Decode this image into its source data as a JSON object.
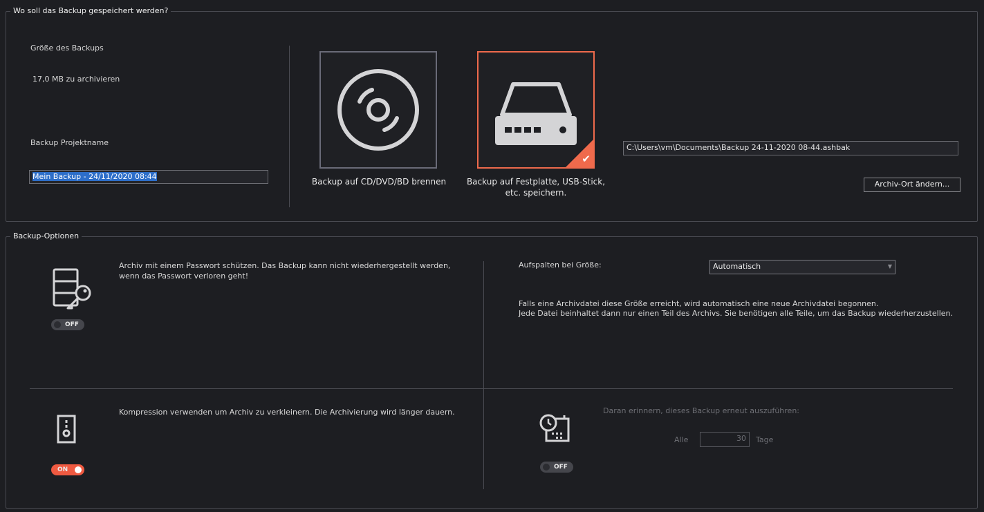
{
  "storage": {
    "legend": "Wo soll das Backup gespeichert werden?",
    "size_label": "Größe des Backups",
    "size_value": "17,0 MB zu archivieren",
    "project_label": "Backup Projektname",
    "project_value": "Mein Backup - 24/11/2020 08:44",
    "option_disc_label": "Backup auf CD/DVD/BD brennen",
    "option_hdd_label_line1": "Backup auf Festplatte, USB-Stick,",
    "option_hdd_label_line2": "etc. speichern.",
    "path_value": "C:\\Users\\vm\\Documents\\Backup 24-11-2020 08-44.ashbak",
    "change_location_button": "Archiv-Ort ändern..."
  },
  "options": {
    "legend": "Backup-Optionen",
    "password": {
      "text_line1": "Archiv mit einem Passwort schützen. Das Backup kann nicht wiederhergestellt werden,",
      "text_line2": "wenn das Passwort verloren geht!",
      "toggle": "OFF"
    },
    "split": {
      "label": "Aufspalten bei Größe:",
      "selected": "Automatisch",
      "info_line1": "Falls eine Archivdatei diese Größe erreicht, wird automatisch eine neue Archivdatei begonnen.",
      "info_line2": "Jede Datei beinhaltet dann nur einen Teil des Archivs. Sie benötigen alle Teile, um das Backup wiederherzustellen."
    },
    "compression": {
      "text": "Kompression verwenden um Archiv zu verkleinern. Die Archivierung wird länger dauern.",
      "toggle": "ON"
    },
    "reminder": {
      "text": "Daran erinnern, dieses Backup erneut auszuführen:",
      "every_label": "Alle",
      "days_value": "30",
      "days_unit": "Tage",
      "toggle": "OFF"
    }
  },
  "colors": {
    "accent": "#ef6a4c",
    "background": "#1d1e22",
    "border": "#4a4b52"
  }
}
